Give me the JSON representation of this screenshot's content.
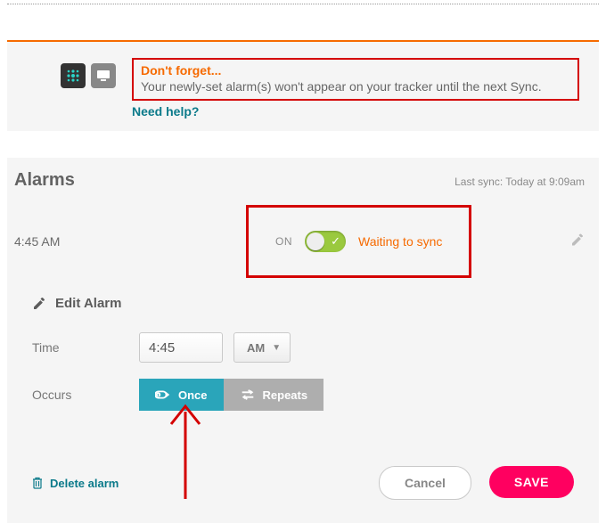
{
  "banner": {
    "title": "Don't forget...",
    "body": "Your newly-set alarm(s) won't appear on your tracker until the next Sync.",
    "help": "Need help?"
  },
  "alarms": {
    "title": "Alarms",
    "last_sync": "Last sync: Today at 9:09am"
  },
  "row": {
    "time": "4:45 AM",
    "state_label": "ON",
    "status": "Waiting to sync"
  },
  "edit": {
    "title": "Edit Alarm",
    "time_label": "Time",
    "time_value": "4:45",
    "ampm": "AM",
    "occurs_label": "Occurs",
    "once": "Once",
    "repeats": "Repeats"
  },
  "footer": {
    "delete": "Delete alarm",
    "cancel": "Cancel",
    "save": "SAVE"
  },
  "colors": {
    "accent_orange": "#f66a00",
    "accent_teal": "#2aa5ba",
    "accent_pink": "#ff0060",
    "annotation_red": "#d40000",
    "toggle_green": "#9ac93e"
  }
}
